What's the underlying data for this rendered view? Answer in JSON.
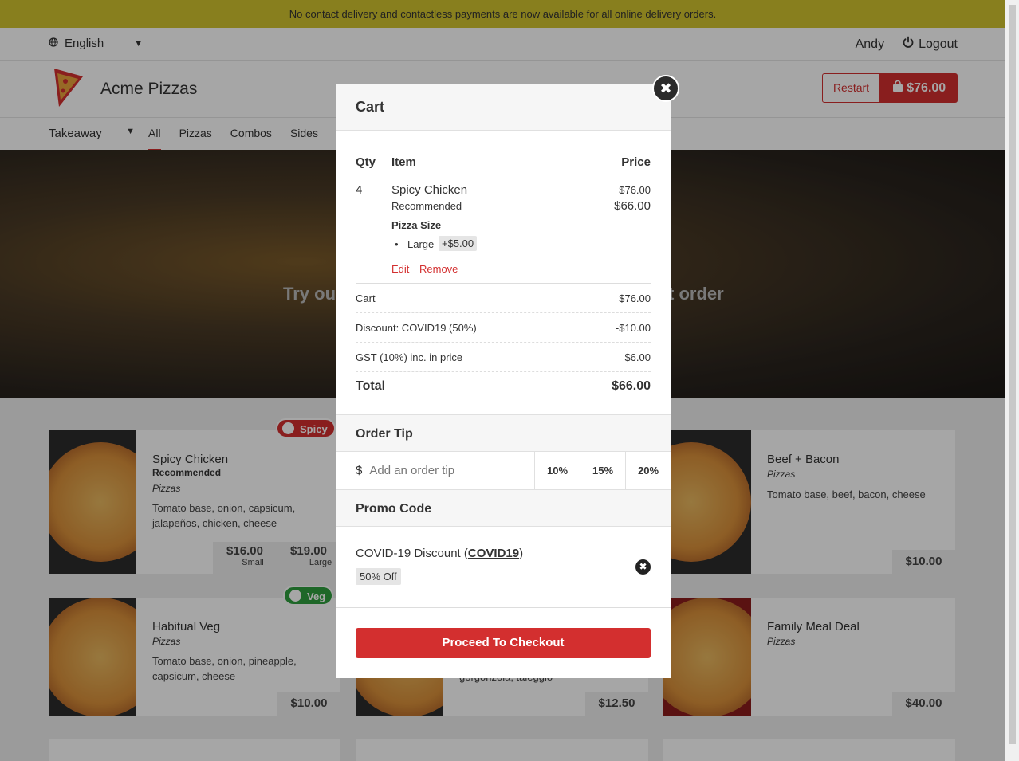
{
  "banner": {
    "text": "No contact delivery and contactless payments are now available for all online delivery orders."
  },
  "topbar": {
    "language": "English",
    "user": "Andy",
    "logout": "Logout"
  },
  "header": {
    "brand": "Acme Pizzas",
    "restart": "Restart",
    "cart_total": "$76.00"
  },
  "nav": {
    "order_type": "Takeaway",
    "tabs": [
      {
        "label": "All"
      },
      {
        "label": "Pizzas"
      },
      {
        "label": "Combos"
      },
      {
        "label": "Sides"
      }
    ]
  },
  "hero": {
    "text_left": "Try out",
    "text_right": "t order"
  },
  "menu": {
    "spicy_chicken": {
      "name": "Spicy Chicken",
      "sub": "Recommended",
      "category": "Pizzas",
      "desc": "Tomato base, onion, capsicum, jalapeños, chicken, cheese",
      "badge": "Spicy",
      "price_small": "$16.00",
      "label_small": "Small",
      "price_large": "$19.00",
      "label_large": "Large"
    },
    "beef_bacon": {
      "name": "Beef + Bacon",
      "category": "Pizzas",
      "desc": "Tomato base, beef, bacon, cheese",
      "price": "$10.00"
    },
    "habitual_veg": {
      "name": "Habitual Veg",
      "category": "Pizzas",
      "desc": "Tomato base, onion, pineapple, capsicum, cheese",
      "badge": "Veg",
      "price": "$10.00"
    },
    "middle": {
      "desc": "gorgonzola, taleggio",
      "price": "$12.50"
    },
    "family_meal": {
      "name": "Family Meal Deal",
      "category": "Pizzas",
      "price": "$40.00"
    }
  },
  "cart": {
    "title": "Cart",
    "close": "✖",
    "headers": {
      "qty": "Qty",
      "item": "Item",
      "price": "Price"
    },
    "item": {
      "qty": "4",
      "name": "Spicy Chicken",
      "sub": "Recommended",
      "option_group": "Pizza Size",
      "option": "Large",
      "option_price": "+$5.00",
      "old_price": "$76.00",
      "price": "$66.00",
      "edit": "Edit",
      "remove": "Remove"
    },
    "summary": [
      {
        "label": "Cart",
        "value": "$76.00"
      },
      {
        "label": "Discount: COVID19 (50%)",
        "value": "-$10.00"
      },
      {
        "label": "GST (10%) inc. in price",
        "value": "$6.00"
      }
    ],
    "total_label": "Total",
    "total_value": "$66.00",
    "tip": {
      "title": "Order Tip",
      "currency": "$",
      "placeholder": "Add an order tip",
      "options": [
        "10%",
        "15%",
        "20%"
      ]
    },
    "promo": {
      "title": "Promo Code",
      "name": "COVID-19 Discount",
      "code": "COVID19",
      "tag": "50% Off",
      "remove": "✖"
    },
    "checkout": "Proceed To Checkout"
  },
  "colors": {
    "accent": "#d32f2f",
    "banner": "#d2c42e",
    "veg": "#2e9e3e"
  }
}
